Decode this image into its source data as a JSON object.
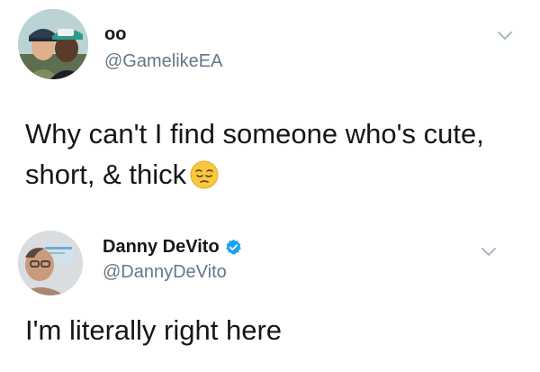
{
  "tweets": [
    {
      "display_name": "oo",
      "handle": "@GamelikeEA",
      "text_line1": "Why can't I find someone who's cute,",
      "text_line2": "short, & thick",
      "emoji": "pensive-face",
      "verified": false,
      "menu_icon": "chevron-down-icon"
    },
    {
      "display_name": "Danny DeVito",
      "handle": "@DannyDeVito",
      "text_line1": "I'm literally right here",
      "verified": true,
      "menu_icon": "chevron-down-icon"
    }
  ],
  "colors": {
    "text": "#14171a",
    "secondary_text": "#657786",
    "verified_blue": "#1da1f2",
    "chevron": "#aab8c2"
  }
}
